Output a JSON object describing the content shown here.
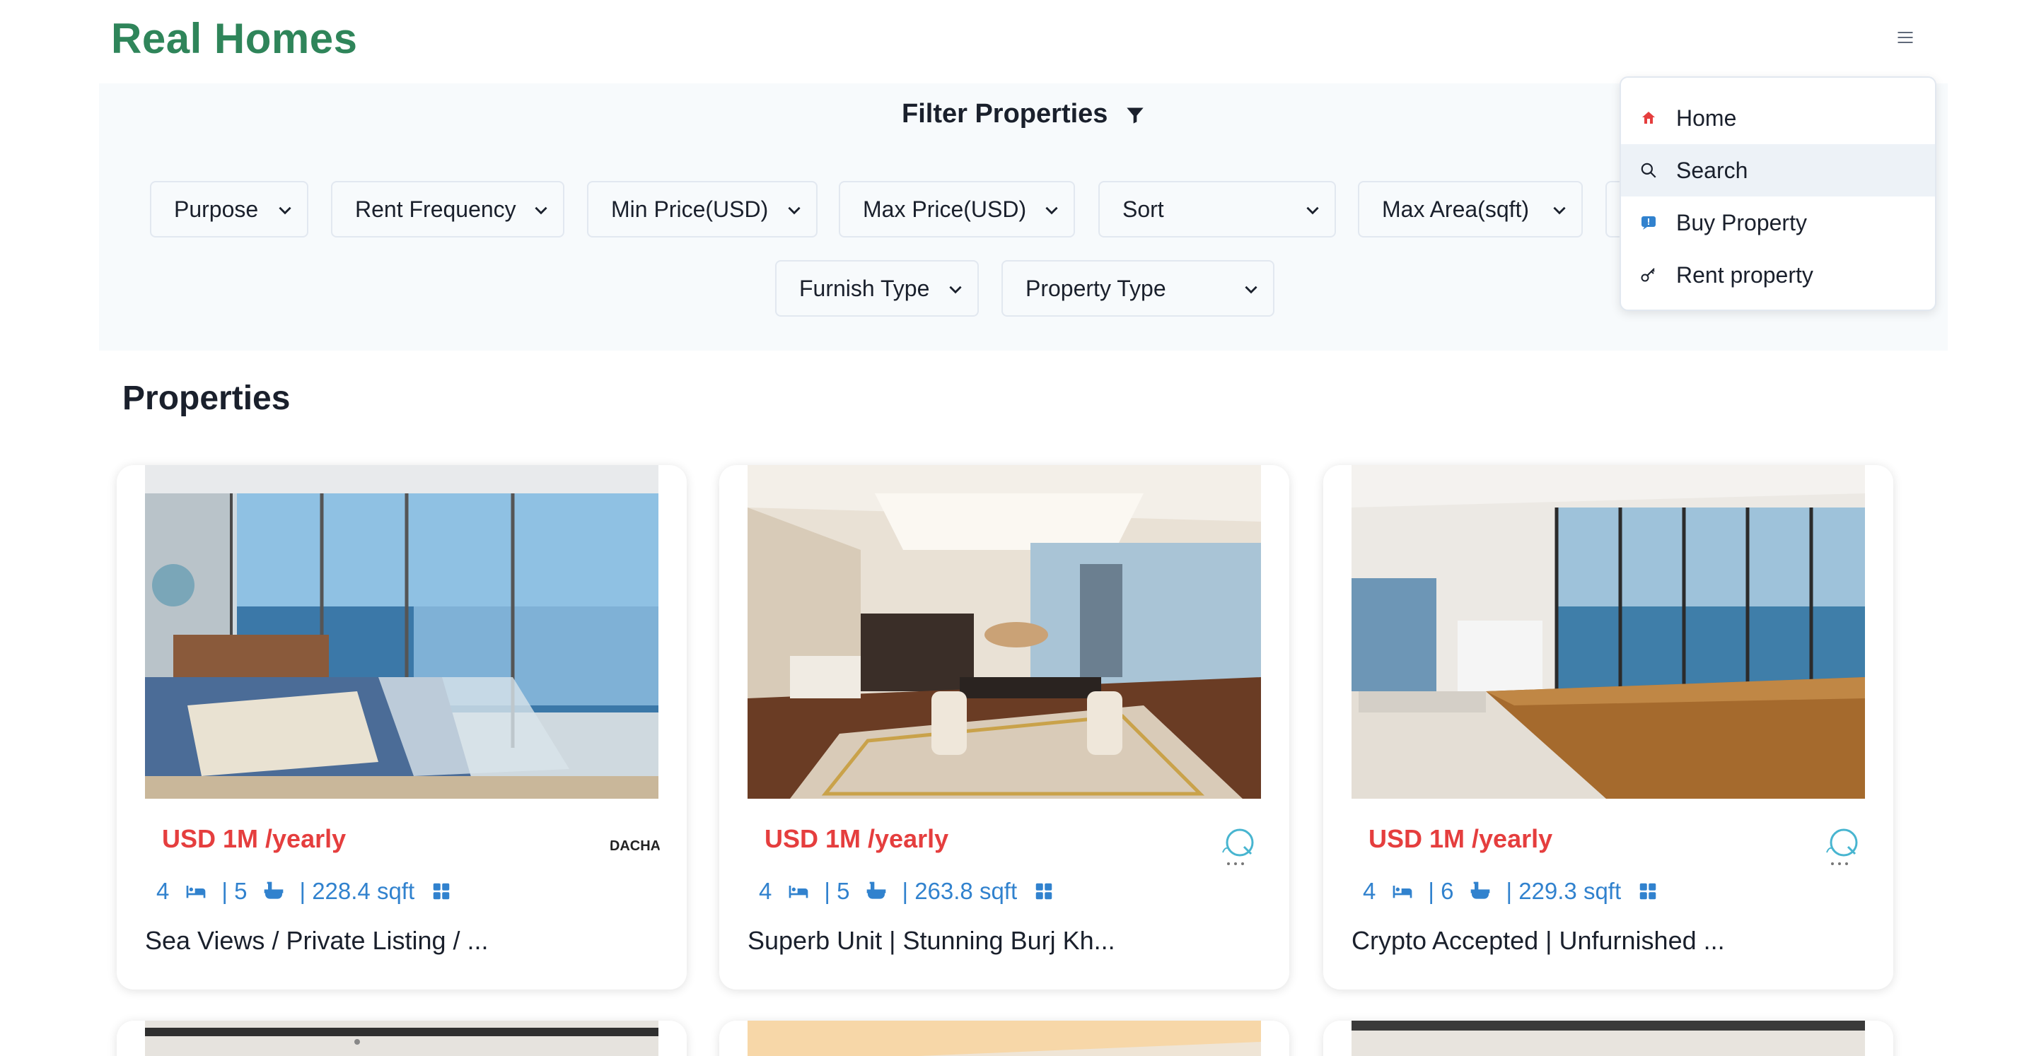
{
  "app": {
    "title": "Real Homes"
  },
  "nav": {
    "menu_icon": "hamburger-icon",
    "items": [
      {
        "label": "Home",
        "icon": "home-icon"
      },
      {
        "label": "Search",
        "icon": "search-icon"
      },
      {
        "label": "Buy Property",
        "icon": "buy-icon"
      },
      {
        "label": "Rent property",
        "icon": "key-icon"
      }
    ]
  },
  "filters": {
    "title": "Filter Properties",
    "selects": [
      {
        "label": "Purpose"
      },
      {
        "label": "Rent Frequency"
      },
      {
        "label": "Min Price(USD)"
      },
      {
        "label": "Max Price(USD)"
      },
      {
        "label": "Sort"
      },
      {
        "label": "Max Area(sqft)"
      },
      {
        "label": "Furnish Type"
      },
      {
        "label": "Property Type"
      }
    ]
  },
  "properties": {
    "heading": "Properties",
    "cards": [
      {
        "price": "USD 1M /yearly",
        "rooms": "4",
        "baths": "| 5",
        "area": "| 228.4 sqft",
        "title": "Sea Views / Private Listing / ...",
        "agency": "DACHA"
      },
      {
        "price": "USD 1M /yearly",
        "rooms": "4",
        "baths": "| 5",
        "area": "| 263.8 sqft",
        "title": "Superb Unit | Stunning Burj Kh...",
        "agency": "aqua-logo"
      },
      {
        "price": "USD 1M /yearly",
        "rooms": "4",
        "baths": "| 6",
        "area": "| 229.3 sqft",
        "title": "Crypto Accepted | Unfurnished ...",
        "agency": "aqua-logo"
      }
    ]
  },
  "colors": {
    "brand": "#2f855a",
    "price": "#e53e3e",
    "stats": "#3182ce",
    "panel": "#f7fafc"
  }
}
